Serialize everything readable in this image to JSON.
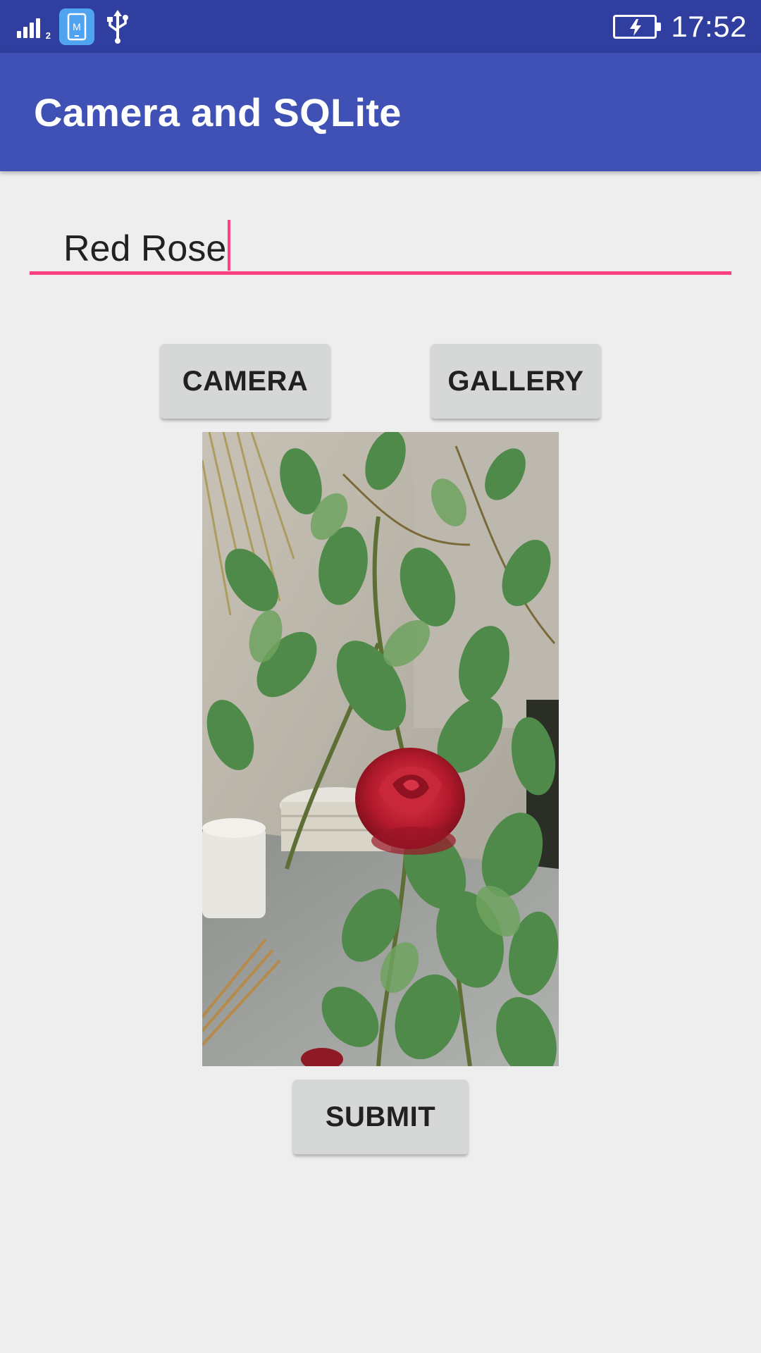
{
  "status_bar": {
    "signal_sub": "2",
    "notification_app_letter": "M",
    "time": "17:52"
  },
  "app_bar": {
    "title": "Camera and SQLite"
  },
  "form": {
    "name_value": "Red Rose",
    "camera_label": "CAMERA",
    "gallery_label": "GALLERY",
    "submit_label": "SUBMIT"
  },
  "colors": {
    "status_bar": "#303f9f",
    "primary": "#3f51b5",
    "accent": "#ff4081",
    "button": "#d6d7d7",
    "background": "#eeeeee"
  },
  "icons": [
    "signal-icon",
    "app-notification-icon",
    "usb-icon",
    "battery-charging-icon"
  ]
}
